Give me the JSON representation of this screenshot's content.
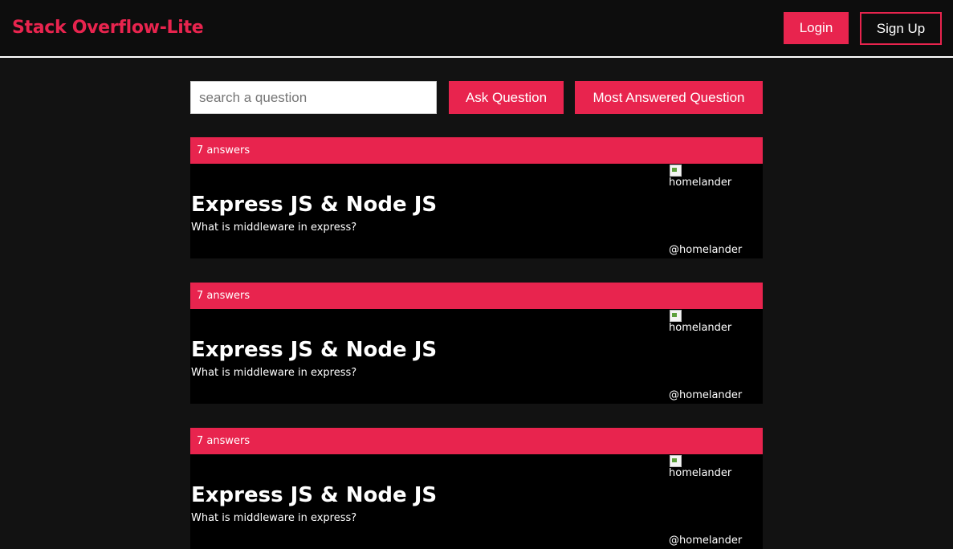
{
  "navbar": {
    "brand": "Stack Overflow-Lite",
    "login_label": "Login",
    "signup_label": "Sign Up"
  },
  "search": {
    "placeholder": "search a question",
    "value": ""
  },
  "actions": {
    "ask_label": "Ask Question",
    "most_answered_label": "Most Answered Question"
  },
  "colors": {
    "accent": "#e8244e",
    "background": "#121212",
    "card_body": "#000000"
  },
  "questions": [
    {
      "answers": "7 answers",
      "title": "Express JS & Node JS",
      "description": "What is middleware in express?",
      "avatar_alt": "homelander",
      "username": "@homelander"
    },
    {
      "answers": "7 answers",
      "title": "Express JS & Node JS",
      "description": "What is middleware in express?",
      "avatar_alt": "homelander",
      "username": "@homelander"
    },
    {
      "answers": "7 answers",
      "title": "Express JS & Node JS",
      "description": "What is middleware in express?",
      "avatar_alt": "homelander",
      "username": "@homelander"
    }
  ]
}
